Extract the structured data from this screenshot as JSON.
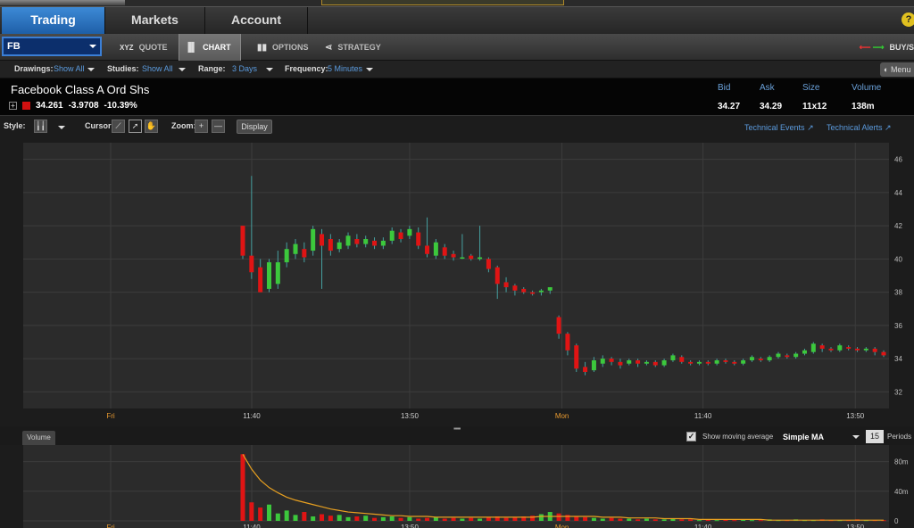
{
  "main_tabs": [
    {
      "label": "Trading",
      "active": true
    },
    {
      "label": "Markets",
      "active": false
    },
    {
      "label": "Account",
      "active": false
    }
  ],
  "help_icon": "?",
  "symbol": "FB",
  "sub_tabs": [
    {
      "label": "QUOTE",
      "icon": "XYZ",
      "active": false
    },
    {
      "label": "CHART",
      "icon": "bar-chart-icon",
      "active": true
    },
    {
      "label": "OPTIONS",
      "icon": "options-icon",
      "active": false
    },
    {
      "label": "STRATEGY",
      "icon": "strategy-icon",
      "active": false
    }
  ],
  "buy_sell_label": "BUY/S",
  "settings": {
    "drawings_label": "Drawings:",
    "drawings_value": "Show All",
    "studies_label": "Studies:",
    "studies_value": "Show All",
    "range_label": "Range:",
    "range_value": "3 Days",
    "frequency_label": "Frequency:",
    "frequency_value": "5 Minutes",
    "menu_label": "Menu"
  },
  "quote": {
    "name": "Facebook Class A  Ord Shs",
    "last": "34.261",
    "change": "-3.9708",
    "change_pct": "-10.39%",
    "headers": {
      "bid": "Bid",
      "ask": "Ask",
      "size": "Size",
      "volume": "Volume"
    },
    "bid": "34.27",
    "ask": "34.29",
    "size": "11x12",
    "volume": "138m"
  },
  "controls": {
    "style_label": "Style:",
    "cursor_label": "Cursor:",
    "zoom_label": "Zoom:",
    "zoom_in": "+",
    "zoom_out": "—",
    "display_label": "Display",
    "technical_events": "Technical Events",
    "technical_alerts": "Technical Alerts"
  },
  "volume_panel": {
    "tab_label": "Volume",
    "show_ma_label": "Show moving average",
    "ma_type": "Simple MA",
    "period": "15",
    "periods_label": "Periods"
  },
  "colors": {
    "up": "#3cc83c",
    "down": "#e01414",
    "accent": "#2f7fd0",
    "ma": "#e8a020"
  },
  "chart_data": {
    "type": "candlestick",
    "y_ticks": [
      32,
      34,
      36,
      38,
      40,
      42,
      44,
      46
    ],
    "ylim": [
      31,
      47
    ],
    "x_labels": [
      {
        "label": "Fri",
        "highlight": true
      },
      {
        "label": "11:40",
        "highlight": false
      },
      {
        "label": "13:50",
        "highlight": false
      },
      {
        "label": "Mon",
        "highlight": true
      },
      {
        "label": "11:40",
        "highlight": false
      },
      {
        "label": "13:50",
        "highlight": false
      }
    ],
    "x_label_index": [
      0,
      1.25,
      2.65,
      4.0,
      5.25,
      6.6
    ],
    "candles": [
      [
        42,
        40.2,
        42,
        40
      ],
      [
        40.2,
        39.2,
        45,
        38.8
      ],
      [
        39.5,
        38,
        40,
        38
      ],
      [
        38.2,
        39.8,
        40,
        38
      ],
      [
        38.5,
        39.8,
        40.5,
        38.2
      ],
      [
        39.8,
        40.6,
        41,
        39.5
      ],
      [
        40.3,
        40.9,
        41.2,
        40
      ],
      [
        40.6,
        40.1,
        41,
        39.8
      ],
      [
        40.5,
        41.8,
        42,
        40.2
      ],
      [
        41.5,
        40.8,
        41.8,
        38.2
      ],
      [
        41.2,
        40.5,
        41.5,
        40.2
      ],
      [
        40.6,
        41,
        41.2,
        40.4
      ],
      [
        40.8,
        41.4,
        41.6,
        40.6
      ],
      [
        41.2,
        40.9,
        41.5,
        40.7
      ],
      [
        40.9,
        41.2,
        41.4,
        40.7
      ],
      [
        41.1,
        40.8,
        41.3,
        40.6
      ],
      [
        40.8,
        41.1,
        41.3,
        40.6
      ],
      [
        41.1,
        41.7,
        41.9,
        40.9
      ],
      [
        41.6,
        41.2,
        41.8,
        41
      ],
      [
        41.4,
        41.8,
        42,
        41.2
      ],
      [
        41.6,
        40.8,
        41.9,
        40.6
      ],
      [
        40.8,
        40.3,
        42.5,
        40.1
      ],
      [
        40.2,
        41,
        41.2,
        40
      ],
      [
        40.7,
        40.2,
        40.9,
        40
      ],
      [
        40.3,
        40.1,
        40.5,
        39.9
      ],
      [
        40.1,
        40.1,
        41.5,
        40
      ],
      [
        40.2,
        40,
        40.3,
        39.9
      ],
      [
        40,
        40.1,
        42,
        39.9
      ],
      [
        40,
        39.4,
        40.1,
        39.2
      ],
      [
        39.5,
        38.5,
        39.6,
        37.6
      ],
      [
        38.6,
        38.3,
        38.9,
        38
      ],
      [
        38.4,
        38.1,
        38.5,
        37.8
      ],
      [
        38.2,
        38,
        38.3,
        37.9
      ],
      [
        38,
        37.9,
        38.1,
        37.8
      ],
      [
        38,
        38.1,
        38.2,
        37.8
      ],
      [
        38.1,
        38.3,
        38.3,
        37.9
      ],
      [
        36.5,
        35.5,
        36.6,
        35.2
      ],
      [
        35.5,
        34.5,
        35.6,
        34.2
      ],
      [
        34.8,
        33.4,
        34.9,
        33.2
      ],
      [
        33.5,
        33.2,
        33.8,
        33
      ],
      [
        33.3,
        33.9,
        34.1,
        33.2
      ],
      [
        33.7,
        34,
        34.2,
        33.5
      ],
      [
        34,
        33.8,
        34.1,
        33.6
      ],
      [
        33.8,
        33.6,
        34,
        33.4
      ],
      [
        33.7,
        33.9,
        34,
        33.6
      ],
      [
        33.9,
        33.7,
        34,
        33.5
      ],
      [
        33.7,
        33.8,
        33.9,
        33.6
      ],
      [
        33.8,
        33.6,
        33.9,
        33.5
      ],
      [
        33.6,
        33.9,
        34,
        33.5
      ],
      [
        33.9,
        34.2,
        34.3,
        33.8
      ],
      [
        34.1,
        33.8,
        34.2,
        33.7
      ],
      [
        33.8,
        33.7,
        33.9,
        33.6
      ],
      [
        33.7,
        33.8,
        33.9,
        33.6
      ],
      [
        33.8,
        33.7,
        33.9,
        33.6
      ],
      [
        33.7,
        33.9,
        34,
        33.6
      ],
      [
        33.9,
        33.8,
        34,
        33.7
      ],
      [
        33.8,
        33.7,
        33.9,
        33.6
      ],
      [
        33.7,
        33.9,
        34,
        33.6
      ],
      [
        33.9,
        34.1,
        34.2,
        33.8
      ],
      [
        34,
        33.9,
        34.1,
        33.8
      ],
      [
        33.9,
        34.1,
        34.2,
        33.8
      ],
      [
        34.1,
        34.3,
        34.4,
        34
      ],
      [
        34.2,
        34.1,
        34.3,
        34
      ],
      [
        34.1,
        34.3,
        34.4,
        34
      ],
      [
        34.3,
        34.5,
        34.6,
        34.2
      ],
      [
        34.4,
        34.9,
        35,
        34.3
      ],
      [
        34.8,
        34.6,
        34.9,
        34.4
      ],
      [
        34.6,
        34.5,
        34.7,
        34.4
      ],
      [
        34.5,
        34.8,
        34.9,
        34.4
      ],
      [
        34.7,
        34.6,
        34.8,
        34.5
      ],
      [
        34.6,
        34.5,
        34.7,
        34.4
      ],
      [
        34.5,
        34.6,
        34.7,
        34.4
      ],
      [
        34.6,
        34.4,
        34.7,
        34.2
      ],
      [
        34.4,
        34.2,
        34.5,
        34.1
      ]
    ],
    "volume": {
      "y_ticks_labels": [
        "80m",
        "40m",
        "0"
      ],
      "y_ticks_values": [
        80,
        40,
        0
      ],
      "ylim": [
        0,
        100
      ],
      "values": [
        90,
        25,
        18,
        22,
        10,
        14,
        8,
        12,
        6,
        9,
        7,
        8,
        5,
        6,
        7,
        4,
        5,
        6,
        4,
        5,
        3,
        4,
        5,
        3,
        4,
        3,
        4,
        3,
        5,
        6,
        4,
        5,
        6,
        7,
        9,
        12,
        10,
        8,
        6,
        5,
        4,
        3,
        4,
        3,
        3,
        2,
        3,
        2,
        2,
        3,
        2,
        2,
        1,
        2,
        1,
        2,
        1,
        2,
        1,
        1,
        2,
        1,
        1,
        2,
        1,
        1,
        2,
        1,
        1,
        1,
        2,
        1,
        1,
        1
      ],
      "ma": [
        90,
        70,
        55,
        45,
        38,
        32,
        28,
        25,
        22,
        19,
        16,
        14,
        12,
        11,
        10,
        9,
        8,
        7,
        7,
        6,
        6,
        6,
        5,
        5,
        5,
        5,
        5,
        5,
        5,
        5,
        5,
        5,
        5,
        5,
        6,
        6,
        6,
        6,
        6,
        6,
        6,
        5,
        5,
        5,
        4,
        4,
        4,
        4,
        3,
        3,
        3,
        3,
        2,
        2,
        2,
        2,
        2,
        2,
        2,
        2,
        1,
        1,
        1,
        1,
        1,
        1,
        1,
        1,
        1,
        1,
        1,
        1,
        1,
        1
      ]
    }
  }
}
